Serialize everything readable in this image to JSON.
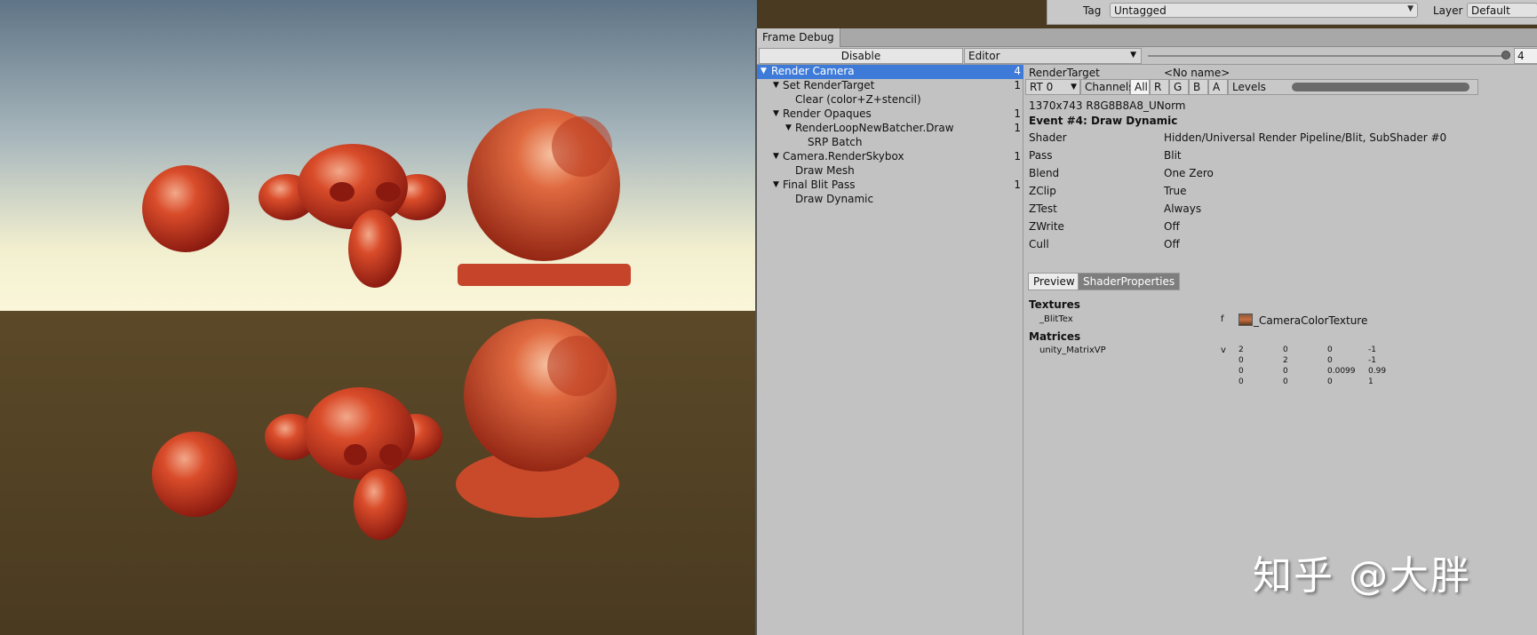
{
  "inspector": {
    "tag_label": "Tag",
    "tag_value": "Untagged",
    "layer_label": "Layer",
    "layer_value": "Default"
  },
  "frame_debug": {
    "tab_title": "Frame Debug",
    "disable_label": "Disable",
    "editor_value": "Editor",
    "event_index": "4",
    "tree": [
      {
        "label": "Render Camera",
        "count": "4",
        "expanded": true,
        "selected": true
      },
      {
        "label": "Set RenderTarget",
        "count": "1",
        "expanded": true
      },
      {
        "label": "Clear (color+Z+stencil)",
        "count": ""
      },
      {
        "label": "Render Opaques",
        "count": "1",
        "expanded": true
      },
      {
        "label": "RenderLoopNewBatcher.Draw",
        "count": "1",
        "expanded": true
      },
      {
        "label": "SRP Batch",
        "count": ""
      },
      {
        "label": "Camera.RenderSkybox",
        "count": "1",
        "expanded": true
      },
      {
        "label": "Draw Mesh",
        "count": ""
      },
      {
        "label": "Final Blit Pass",
        "count": "1",
        "expanded": true
      },
      {
        "label": "Draw Dynamic",
        "count": ""
      }
    ],
    "render_target_label": "RenderTarget",
    "render_target_value": "<No name>",
    "rt_select": "RT 0",
    "channels_label": "Channels",
    "channels": [
      "All",
      "R",
      "G",
      "B",
      "A"
    ],
    "levels_label": "Levels",
    "format": "1370x743 R8G8B8A8_UNorm",
    "event_title": "Event #4: Draw Dynamic",
    "properties": [
      {
        "name": "Shader",
        "value": "Hidden/Universal Render Pipeline/Blit, SubShader #0"
      },
      {
        "name": "Pass",
        "value": "Blit"
      },
      {
        "name": "Blend",
        "value": "One Zero"
      },
      {
        "name": "ZClip",
        "value": "True"
      },
      {
        "name": "ZTest",
        "value": "Always"
      },
      {
        "name": "ZWrite",
        "value": "Off"
      },
      {
        "name": "Cull",
        "value": "Off"
      }
    ],
    "tabs": [
      "Preview",
      "ShaderProperties"
    ],
    "textures_heading": "Textures",
    "texture": {
      "name": "_BlitTex",
      "stage": "f",
      "value": "_CameraColorTexture"
    },
    "matrices_heading": "Matrices",
    "matrix": {
      "name": "unity_MatrixVP",
      "stage": "v",
      "rows": [
        [
          "2",
          "0",
          "0",
          "-1"
        ],
        [
          "0",
          "2",
          "0",
          "-1"
        ],
        [
          "0",
          "0",
          "0.0099",
          "0.99"
        ],
        [
          "0",
          "0",
          "0",
          "1"
        ]
      ]
    }
  },
  "watermark": "知乎 @大胖"
}
